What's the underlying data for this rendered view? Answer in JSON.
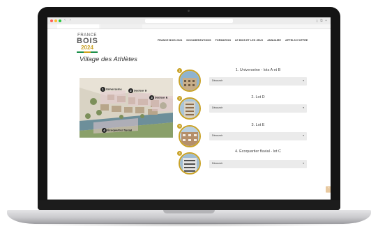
{
  "browser": {
    "nav_arrows": "‹ ›",
    "toolbar_icons": "⤓ ⧉ +"
  },
  "header": {
    "logo": {
      "top": "FRANCE",
      "middle": "BOIS",
      "year": "2024"
    },
    "nav": [
      "FRANCE BOIS 2024",
      "DOCUMENTATIONS",
      "FORMATION",
      "LE BOIS ET LES JEUX",
      "ANNUAIRE",
      "APPELS D'OFFRE"
    ]
  },
  "main": {
    "title": "Village des Athlètes",
    "map_labels": [
      {
        "num": "1",
        "text": "Universeine"
      },
      {
        "num": "2",
        "text": "Secteur D"
      },
      {
        "num": "3",
        "text": "Secteur E"
      },
      {
        "num": "4",
        "text": "Écoquartier fluvial"
      }
    ],
    "lots": [
      {
        "badge": "1",
        "title": "1. Universeine - lots A et B",
        "dropdown": "Découvrir",
        "caret": "▾"
      },
      {
        "badge": "2",
        "title": "2. Lot D",
        "dropdown": "Découvrir",
        "caret": "▾"
      },
      {
        "badge": "3",
        "title": "3. Lot E",
        "dropdown": "Découvrir",
        "caret": "▾"
      },
      {
        "badge": "4",
        "title": "4. Écoquartier fluvial - lot C",
        "dropdown": "Découvrir",
        "caret": "▾"
      }
    ],
    "scroll_top_icon": "⌃"
  },
  "colors": {
    "accent_gold": "#c9a227",
    "dropdown_bg": "#ebebeb",
    "text_dark": "#333333"
  }
}
